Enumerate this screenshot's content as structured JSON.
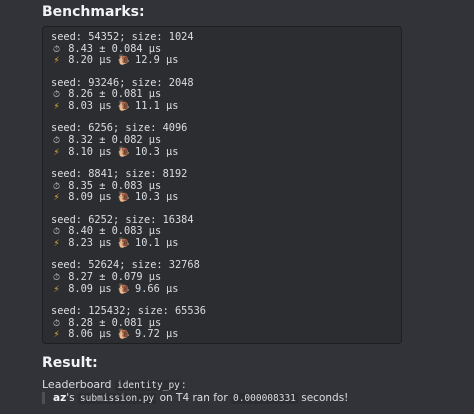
{
  "benchmarks_heading": "Benchmarks:",
  "benchmarks": [
    {
      "seed_line": "seed: 54352; size: 1024",
      "mean_line": "8.43 ± 0.084 µs",
      "fast": "8.20 µs",
      "slow": "12.9 µs"
    },
    {
      "seed_line": "seed: 93246; size: 2048",
      "mean_line": "8.26 ± 0.081 µs",
      "fast": "8.03 µs",
      "slow": "11.1 µs"
    },
    {
      "seed_line": "seed: 6256; size: 4096",
      "mean_line": "8.32 ± 0.082 µs",
      "fast": "8.10 µs",
      "slow": "10.3 µs"
    },
    {
      "seed_line": "seed: 8841; size: 8192",
      "mean_line": "8.35 ± 0.083 µs",
      "fast": "8.09 µs",
      "slow": "10.3 µs"
    },
    {
      "seed_line": "seed: 6252; size: 16384",
      "mean_line": "8.40 ± 0.083 µs",
      "fast": "8.23 µs",
      "slow": "10.1 µs"
    },
    {
      "seed_line": "seed: 52624; size: 32768",
      "mean_line": "8.27 ± 0.079 µs",
      "fast": "8.09 µs",
      "slow": "9.66 µs"
    },
    {
      "seed_line": "seed: 125432; size: 65536",
      "mean_line": "8.28 ± 0.081 µs",
      "fast": "8.06 µs",
      "slow": "9.72 µs"
    }
  ],
  "icons": {
    "mean": "stopwatch-icon",
    "fast": "lightning-icon",
    "slow": "snail-icon"
  },
  "result_heading": "Result:",
  "leaderboard": {
    "prefix": "Leaderboard",
    "name": "identity_py",
    "suffix": ":"
  },
  "result_line": {
    "user": "az",
    "possessive": "'s",
    "file": "submission.py",
    "on": "on T4 ran for",
    "time": "0.000008331",
    "unit": "seconds!"
  }
}
